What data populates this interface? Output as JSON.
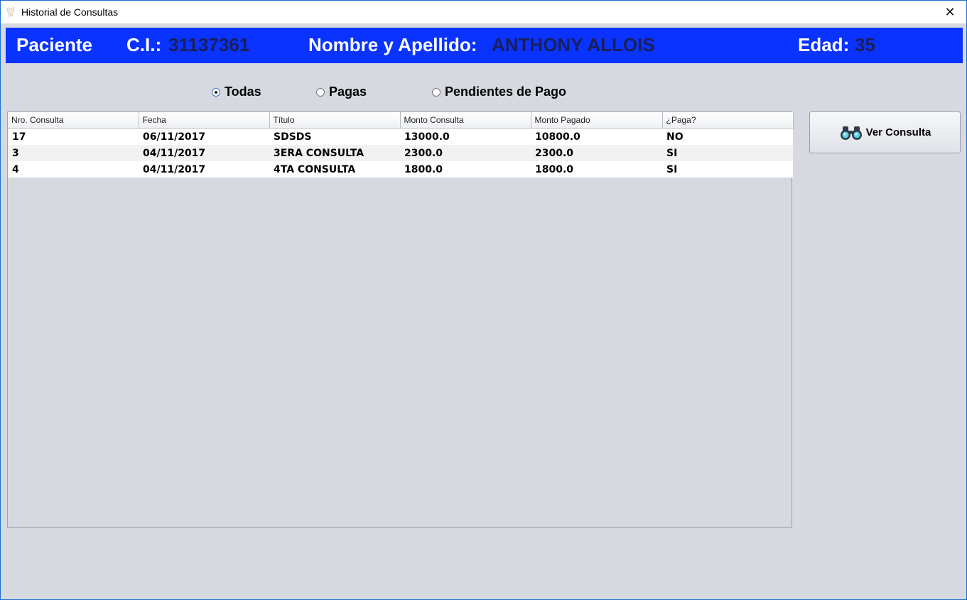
{
  "window": {
    "title": "Historial de Consultas",
    "title_icon": "tooth-icon",
    "close_glyph": "✕"
  },
  "patient": {
    "section_label": "Paciente",
    "ci_label": "C.I.:",
    "ci_value": "31137361",
    "name_label": "Nombre y Apellido:",
    "name_value": "ANTHONY ALLOIS",
    "age_label": "Edad:",
    "age_value": "35",
    "bar_color": "#0a33ff"
  },
  "filters": [
    {
      "label": "Todas",
      "selected": true
    },
    {
      "label": "Pagas",
      "selected": false
    },
    {
      "label": "Pendientes de Pago",
      "selected": false
    }
  ],
  "table": {
    "columns": [
      "Nro. Consulta",
      "Fecha",
      "Título",
      "Monto Consulta",
      "Monto Pagado",
      "¿Paga?"
    ],
    "rows": [
      [
        "17",
        "06/11/2017",
        "SDSDS",
        "13000.0",
        "10800.0",
        "NO"
      ],
      [
        "3",
        "04/11/2017",
        "3ERA CONSULTA",
        "2300.0",
        "2300.0",
        "SI"
      ],
      [
        "4",
        "04/11/2017",
        "4TA CONSULTA",
        "1800.0",
        "1800.0",
        "SI"
      ]
    ]
  },
  "actions": {
    "view_label": "Ver Consulta",
    "view_icon": "binoculars-icon"
  }
}
